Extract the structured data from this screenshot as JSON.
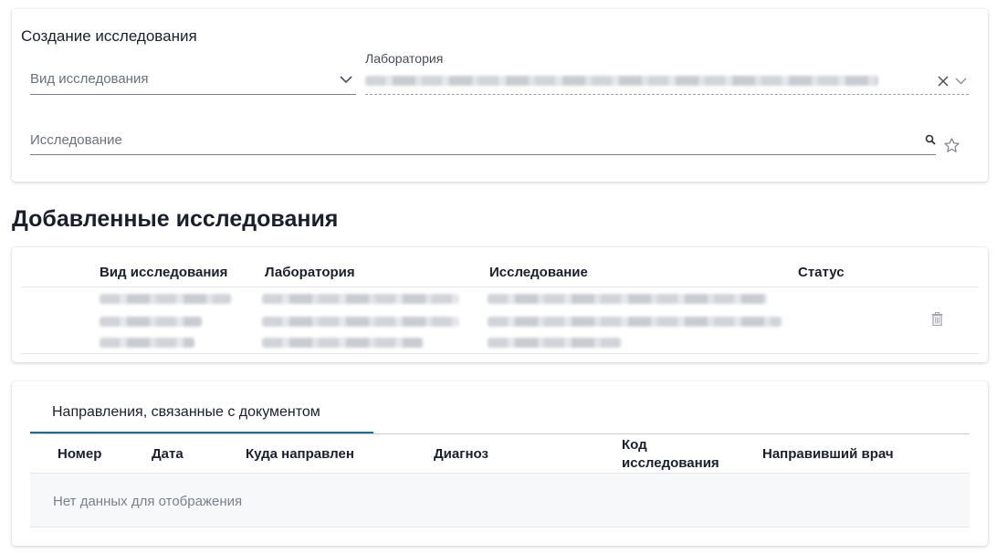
{
  "create": {
    "title": "Создание исследования",
    "study_type_placeholder": "Вид исследования",
    "laboratory_label": "Лаборатория",
    "study_placeholder": "Исследование"
  },
  "added": {
    "heading": "Добавленные исследования",
    "columns": [
      "Вид исследования",
      "Лаборатория",
      "Исследование",
      "Статус"
    ]
  },
  "links": {
    "tab_label": "Направления, связанные с документом",
    "columns": [
      "Номер",
      "Дата",
      "Куда направлен",
      "Диагноз",
      "Код исследования",
      "Направивший врач"
    ],
    "empty_text": "Нет данных для отображения"
  },
  "colors": {
    "accent": "#1f6a8a",
    "text": "#1a1f2b",
    "muted": "#6b7079"
  },
  "icons": [
    "chevron-down-icon",
    "clear-icon",
    "search-icon",
    "star-icon",
    "trash-icon"
  ]
}
